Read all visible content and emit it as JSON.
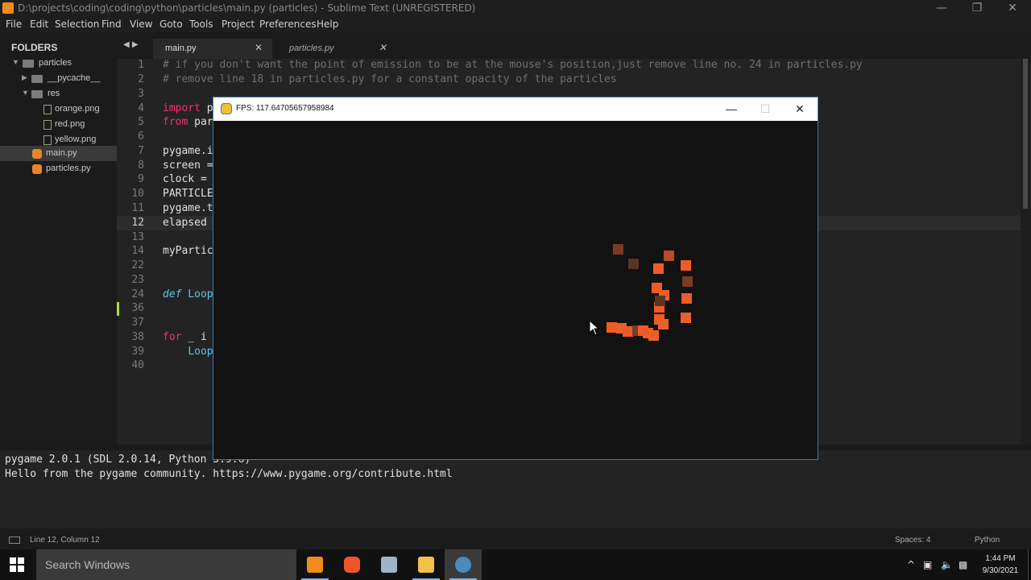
{
  "window": {
    "title": "D:\\projects\\coding\\coding\\python\\particles\\main.py (particles) - Sublime Text (UNREGISTERED)",
    "minimize": "—",
    "maximize": "❐",
    "close": "✕"
  },
  "menu": [
    "File",
    "Edit",
    "Selection",
    "Find",
    "View",
    "Goto",
    "Tools",
    "Project",
    "Preferences",
    "Help"
  ],
  "sidebar": {
    "header": "FOLDERS",
    "items": [
      {
        "label": "particles",
        "kind": "folder-open"
      },
      {
        "label": "__pycache__",
        "kind": "folder"
      },
      {
        "label": "res",
        "kind": "folder-open"
      },
      {
        "label": "orange.png",
        "kind": "image"
      },
      {
        "label": "red.png",
        "kind": "image"
      },
      {
        "label": "yellow.png",
        "kind": "image"
      },
      {
        "label": "main.py",
        "kind": "python"
      },
      {
        "label": "particles.py",
        "kind": "python"
      }
    ]
  },
  "tabs": [
    {
      "label": "main.py",
      "active": true
    },
    {
      "label": "particles.py",
      "active": false
    }
  ],
  "editor": {
    "lines": [
      {
        "n": "1",
        "text": "# if you don't want the point of emission to be at the mouse's position,just remove line no. 24 in particles.py"
      },
      {
        "n": "2",
        "text": "# remove line 18 in particles.py for a constant opacity of the particles"
      },
      {
        "n": "3",
        "text": ""
      },
      {
        "n": "4",
        "kw": "import",
        "text": " p"
      },
      {
        "n": "5",
        "kw": "from",
        "text": " par"
      },
      {
        "n": "6",
        "text": ""
      },
      {
        "n": "7",
        "text": "pygame.i"
      },
      {
        "n": "8",
        "text": "screen ="
      },
      {
        "n": "9",
        "text": "clock ="
      },
      {
        "n": "10",
        "text": "PARTICLE"
      },
      {
        "n": "11",
        "text": "pygame.t"
      },
      {
        "n": "12",
        "text": "elapsed"
      },
      {
        "n": "13",
        "text": ""
      },
      {
        "n": "14",
        "text": "myPartic"
      },
      {
        "n": "22",
        "text": ""
      },
      {
        "n": "23",
        "text": ""
      },
      {
        "n": "24",
        "def": "def",
        "fn": " Loop"
      },
      {
        "n": "36",
        "text": ""
      },
      {
        "n": "37",
        "text": ""
      },
      {
        "n": "38",
        "kw": "for",
        "text": " _ i"
      },
      {
        "n": "39",
        "indent": "    ",
        "fn": "Loop"
      },
      {
        "n": "40",
        "text": ""
      }
    ]
  },
  "console": [
    "pygame 2.0.1 (SDL 2.0.14, Python 3.9.6)",
    "Hello from the pygame community. https://www.pygame.org/contribute.html"
  ],
  "status": {
    "position": "Line 12, Column 12",
    "spaces": "Spaces: 4",
    "syntax": "Python"
  },
  "pygame_window": {
    "title": "FPS: 117.64705657958984",
    "minimize": "—",
    "maximize": "☐",
    "close": "✕"
  },
  "particles_colors": [
    "#f05a28",
    "#e8612a",
    "#b84a25",
    "#7a3b22",
    "#5a3526"
  ],
  "taskbar": {
    "search_placeholder": "Search Windows",
    "time": "1:44 PM",
    "date": "9/30/2021",
    "tray_chevron": "^"
  }
}
